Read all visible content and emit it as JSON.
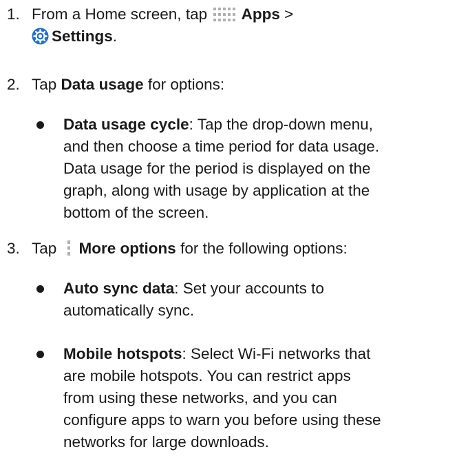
{
  "steps": [
    {
      "number": "1.",
      "text_a": "From a Home screen, tap",
      "apps_label": "Apps",
      "separator": ">",
      "settings_label": "Settings",
      "tail": "."
    },
    {
      "number": "2.",
      "text_a": "Tap",
      "bold": "Data usage",
      "text_b": "for options:",
      "bullets": [
        {
          "title": "Data usage cycle",
          "desc_lines": [
            ": Tap the drop-down menu,",
            "and then choose a time period for data usage.",
            "Data usage for the period is displayed on the",
            "graph, along with usage by application at the",
            "bottom of the screen."
          ]
        }
      ]
    },
    {
      "number": "3.",
      "text_a": "Tap",
      "bold": "More options",
      "text_b": "for the following options:",
      "bullets": [
        {
          "title": "Auto sync data",
          "desc_lines": [
            ": Set your accounts to",
            "automatically sync."
          ]
        },
        {
          "title": "Mobile hotspots",
          "desc_lines": [
            ": Select Wi-Fi networks that",
            "are mobile hotspots. You can restrict apps",
            "from using these networks, and you can",
            "configure apps to warn you before using these",
            "networks for large downloads."
          ]
        }
      ]
    }
  ],
  "icons": {
    "apps": "apps-grid-icon",
    "settings": "settings-gear-icon",
    "more": "more-options-icon"
  },
  "colors": {
    "text": "#1a1a1a",
    "icon_grey": "#b0b0b0",
    "settings_blue": "#1f6fd1"
  }
}
